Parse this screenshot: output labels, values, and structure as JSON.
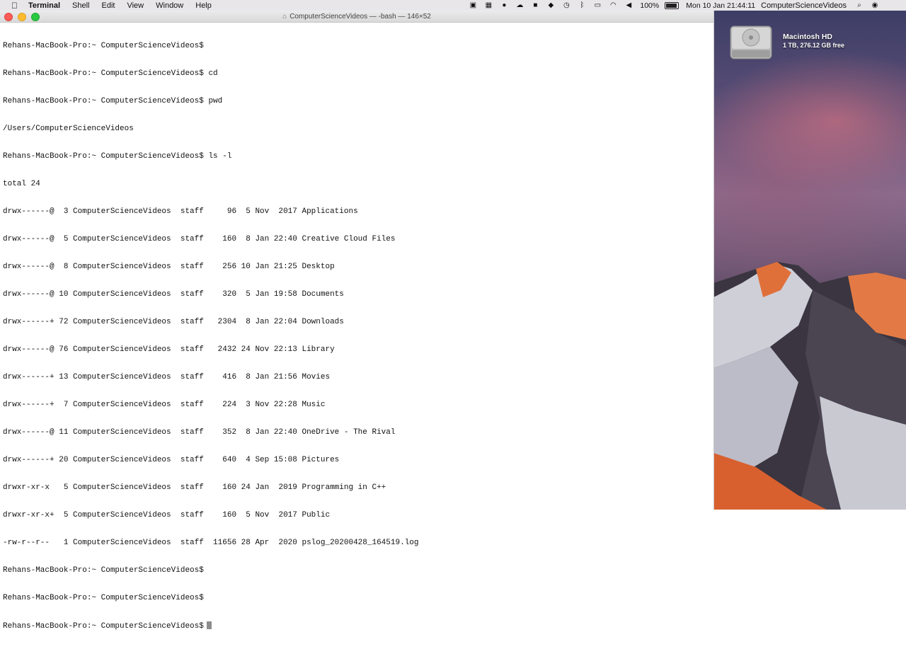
{
  "menubar": {
    "app_name": "Terminal",
    "items": [
      "Shell",
      "Edit",
      "View",
      "Window",
      "Help"
    ],
    "battery": "100%",
    "clock": "Mon 10 Jan  21:44:11",
    "user": "ComputerScienceVideos",
    "status_icons": [
      "screen-record-icon",
      "grid-icon",
      "elephant-icon",
      "cloud-icon",
      "bag-icon",
      "shield-icon",
      "time-machine-icon",
      "bluetooth-icon",
      "airplay-icon",
      "wifi-icon",
      "volume-icon",
      "battery-icon",
      "search-icon",
      "siri-icon"
    ]
  },
  "window": {
    "title": "ComputerScienceVideos — -bash — 146×52",
    "lines": [
      "Rehans-MacBook-Pro:~ ComputerScienceVideos$",
      "Rehans-MacBook-Pro:~ ComputerScienceVideos$ cd",
      "Rehans-MacBook-Pro:~ ComputerScienceVideos$ pwd",
      "/Users/ComputerScienceVideos",
      "Rehans-MacBook-Pro:~ ComputerScienceVideos$ ls -l",
      "total 24",
      "drwx------@  3 ComputerScienceVideos  staff     96  5 Nov  2017 Applications",
      "drwx------@  5 ComputerScienceVideos  staff    160  8 Jan 22:40 Creative Cloud Files",
      "drwx------@  8 ComputerScienceVideos  staff    256 10 Jan 21:25 Desktop",
      "drwx------@ 10 ComputerScienceVideos  staff    320  5 Jan 19:58 Documents",
      "drwx------+ 72 ComputerScienceVideos  staff   2304  8 Jan 22:04 Downloads",
      "drwx------@ 76 ComputerScienceVideos  staff   2432 24 Nov 22:13 Library",
      "drwx------+ 13 ComputerScienceVideos  staff    416  8 Jan 21:56 Movies",
      "drwx------+  7 ComputerScienceVideos  staff    224  3 Nov 22:28 Music",
      "drwx------@ 11 ComputerScienceVideos  staff    352  8 Jan 22:40 OneDrive - The Rival",
      "drwx------+ 20 ComputerScienceVideos  staff    640  4 Sep 15:08 Pictures",
      "drwxr-xr-x   5 ComputerScienceVideos  staff    160 24 Jan  2019 Programming in C++",
      "drwxr-xr-x+  5 ComputerScienceVideos  staff    160  5 Nov  2017 Public",
      "-rw-r--r--   1 ComputerScienceVideos  staff  11656 28 Apr  2020 pslog_20200428_164519.log",
      "Rehans-MacBook-Pro:~ ComputerScienceVideos$",
      "Rehans-MacBook-Pro:~ ComputerScienceVideos$"
    ],
    "prompt": "Rehans-MacBook-Pro:~ ComputerScienceVideos$"
  },
  "desktop": {
    "disk_name": "Macintosh HD",
    "disk_info": "1 TB, 276.12 GB free"
  }
}
